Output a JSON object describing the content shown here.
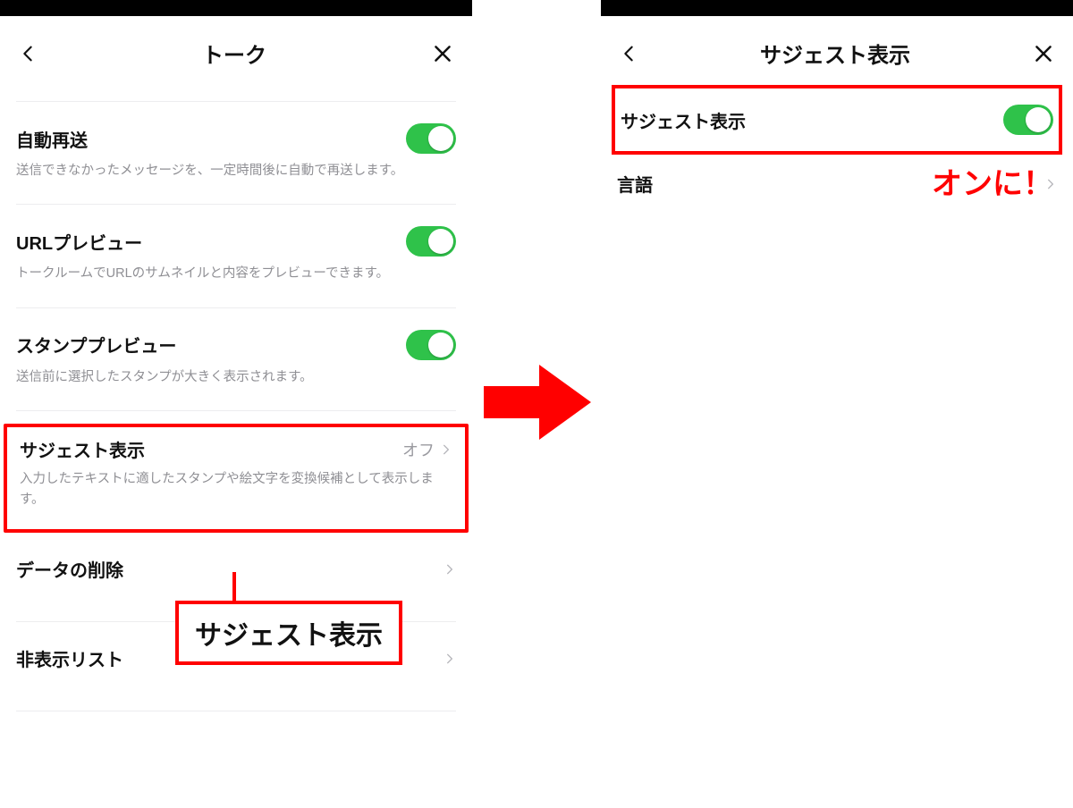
{
  "left": {
    "header_title": "トーク",
    "rows": {
      "auto_resend": {
        "title": "自動再送",
        "desc": "送信できなかったメッセージを、一定時間後に自動で再送します。"
      },
      "url_preview": {
        "title": "URLプレビュー",
        "desc": "トークルームでURLのサムネイルと内容をプレビューできます。"
      },
      "stamp_preview": {
        "title": "スタンププレビュー",
        "desc": "送信前に選択したスタンプが大きく表示されます。"
      },
      "suggest": {
        "title": "サジェスト表示",
        "value": "オフ",
        "desc": "入力したテキストに適したスタンプや絵文字を変換候補として表示します。"
      },
      "delete_data": {
        "title": "データの削除"
      },
      "hidden_list": {
        "title": "非表示リスト"
      }
    },
    "callout_label": "サジェスト表示"
  },
  "right": {
    "header_title": "サジェスト表示",
    "rows": {
      "suggest_toggle": {
        "title": "サジェスト表示"
      },
      "language": {
        "title": "言語"
      }
    },
    "annotation": "オンに！"
  }
}
